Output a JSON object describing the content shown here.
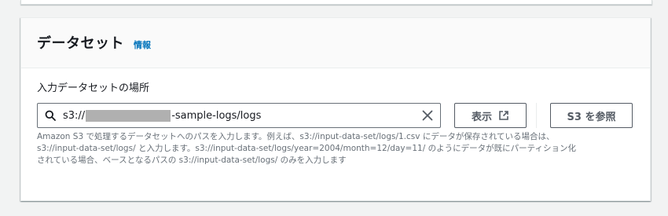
{
  "panel": {
    "title": "データセット",
    "info_link": "情報"
  },
  "location_field": {
    "label": "入力データセットの場所",
    "value_prefix": "s3://",
    "value_suffix": "-sample-logs/logs",
    "value_redacted": true,
    "view_button": "表示",
    "browse_button": "S3 を参照",
    "help_text": [
      "Amazon S3 で処理するデータセットへのパスを入力します。例えば、s3://input-data-set/logs/1.csv にデータが保存されている場合は、",
      "s3://input-data-set/logs/ と入力します。s3://input-data-set/logs/year=2004/month=12/day=11/ のようにデータが既にパーティション化",
      "されている場合、ベースとなるパスの s3://input-data-set/logs/ のみを入力します"
    ]
  },
  "icons": {
    "search": "search-icon",
    "clear": "close-icon",
    "external": "external-link-icon"
  },
  "colors": {
    "link": "#0073bb",
    "border": "#687078",
    "button_text": "#545b64",
    "help_text": "#687078"
  }
}
